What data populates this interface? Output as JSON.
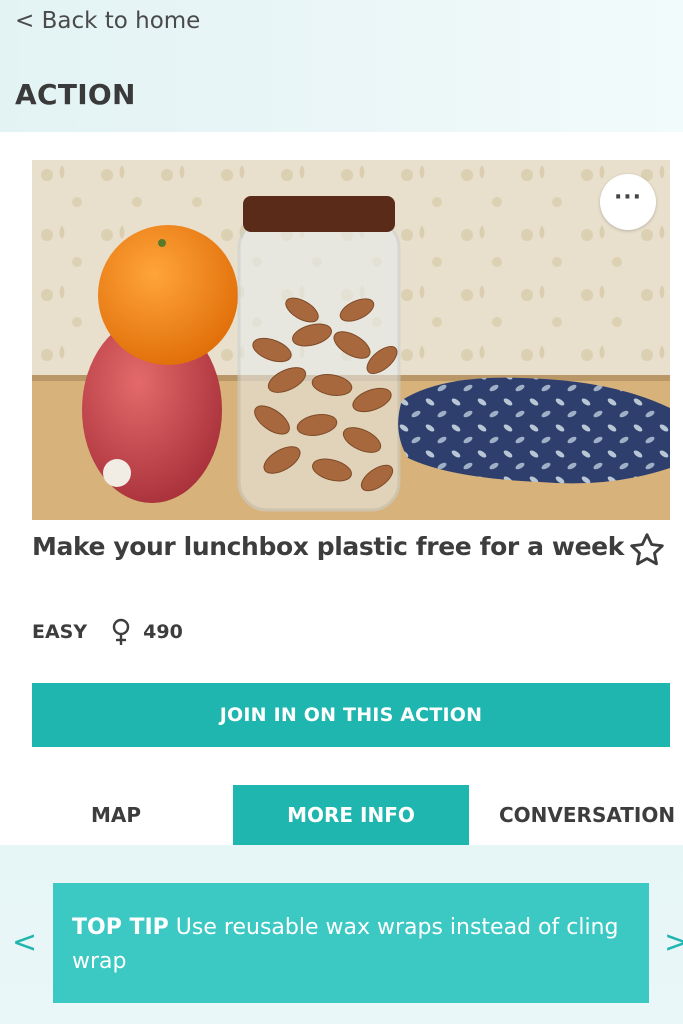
{
  "nav": {
    "back_label": "< Back to home"
  },
  "page": {
    "title": "ACTION"
  },
  "action": {
    "title": "Make your lunchbox plastic free for a week",
    "difficulty": "EASY",
    "participants": "490",
    "join_label": "JOIN IN ON THIS ACTION",
    "more_options_icon": "more-horizontal-icon",
    "favorite_icon": "star-outline-icon"
  },
  "tabs": [
    {
      "label": "MAP",
      "active": false
    },
    {
      "label": "MORE INFO",
      "active": true
    },
    {
      "label": "CONVERSATION",
      "active": false
    }
  ],
  "tip": {
    "label": "TOP TIP",
    "text": " Use reusable wax wraps instead of cling wrap",
    "prev": "<",
    "next": ">"
  },
  "colors": {
    "accent": "#20b6b0",
    "tip_card": "#3cc9c4",
    "header_bg": "#e3f3f4",
    "text": "#3d3d3d"
  }
}
